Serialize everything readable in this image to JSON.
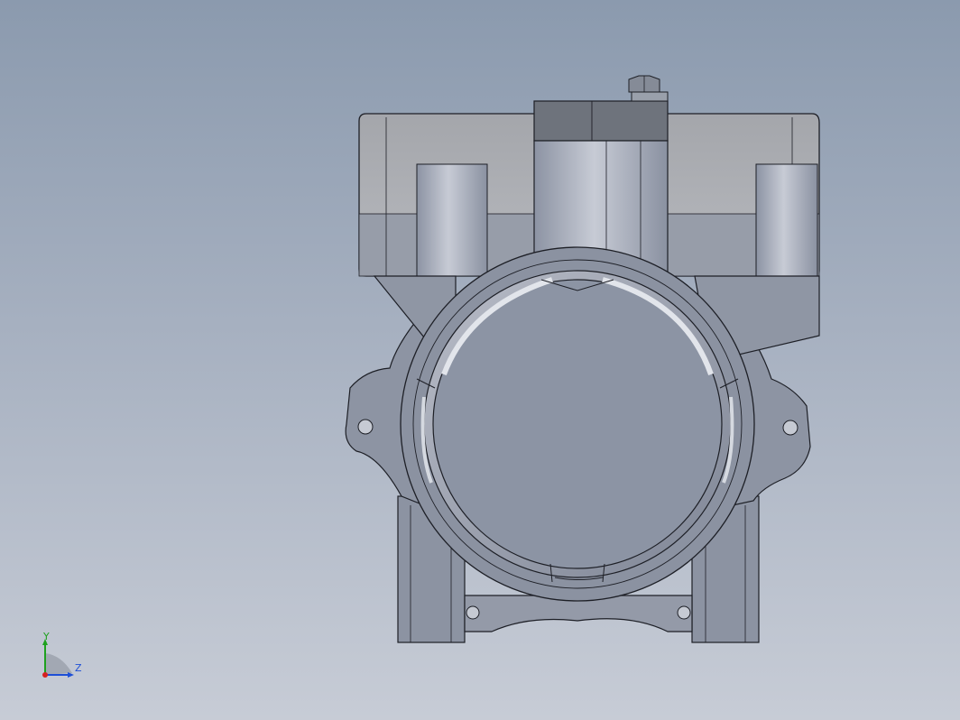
{
  "viewport": {
    "background_top": "#8b9aae",
    "background_bottom": "#c7ccd6"
  },
  "model": {
    "body_color": "#8e95a4",
    "highlight_color": "#c9cdd6",
    "edge_color": "#1d1f26"
  },
  "triad": {
    "y_label": "Y",
    "z_label": "Z",
    "y_color": "#1ea11e",
    "z_color": "#1e4fd6",
    "x_color": "#d62020"
  }
}
